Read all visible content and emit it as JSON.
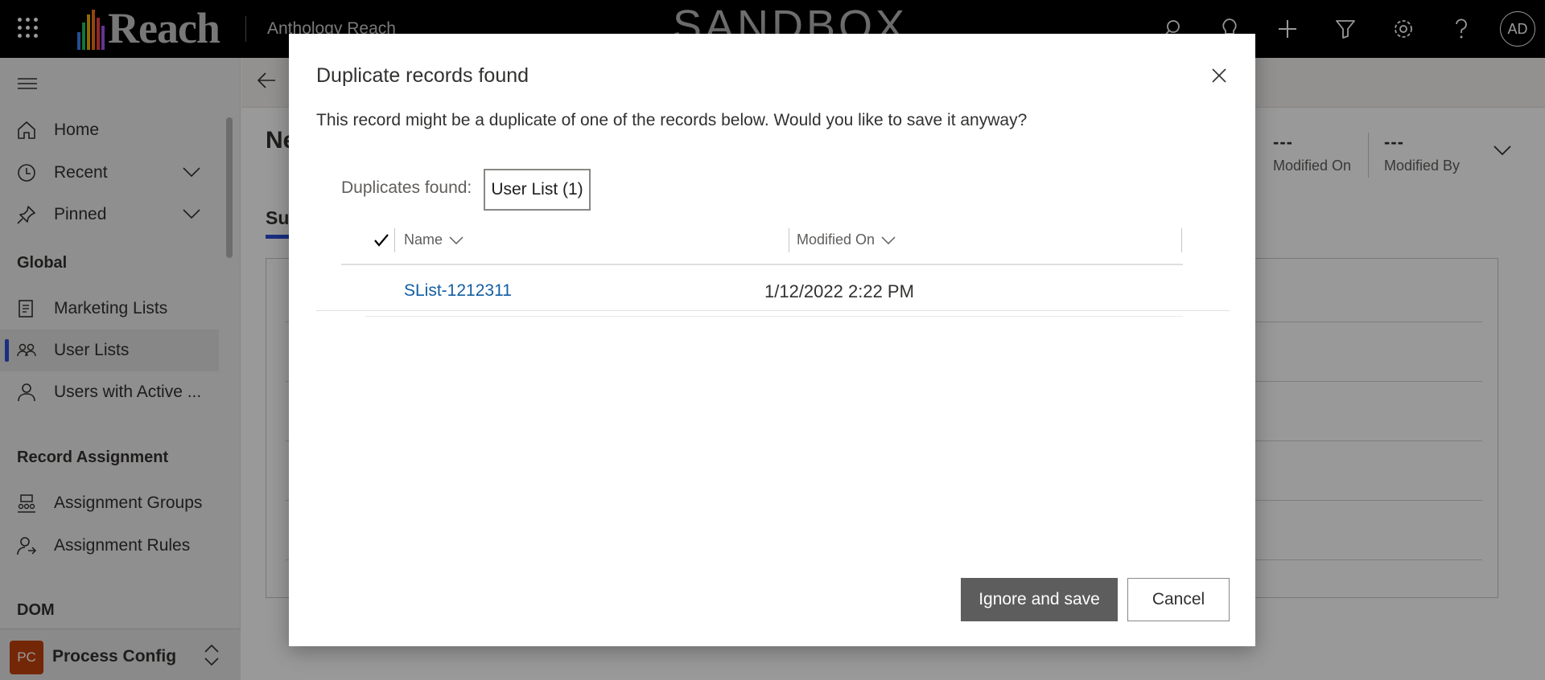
{
  "topbar": {
    "logo_text": "Reach",
    "app_name": "Anthology Reach",
    "environment_banner": "SANDBOX",
    "icons": [
      "search-icon",
      "lightbulb-icon",
      "plus-icon",
      "filter-icon",
      "gear-icon",
      "help-icon"
    ],
    "user_initials": "AD"
  },
  "sidebar": {
    "items_top": [
      {
        "label": "Home",
        "icon": "home-icon"
      },
      {
        "label": "Recent",
        "icon": "clock-icon"
      },
      {
        "label": "Pinned",
        "icon": "pin-icon"
      }
    ],
    "group_global": "Global",
    "items_global": [
      {
        "label": "Marketing Lists",
        "icon": "marketing-list-icon"
      },
      {
        "label": "User Lists",
        "icon": "users-icon"
      },
      {
        "label": "Users with Active ...",
        "icon": "user-icon"
      }
    ],
    "group_assignment": "Record Assignment",
    "items_assignment": [
      {
        "label": "Assignment Groups",
        "icon": "assignment-groups-icon"
      },
      {
        "label": "Assignment Rules",
        "icon": "assignment-rules-icon"
      }
    ],
    "group_dom": "DOM",
    "area": {
      "badge": "PC",
      "label": "Process Config"
    }
  },
  "background": {
    "page_title": "Ne",
    "tab_label": "Su",
    "header_fields": [
      {
        "value": "---",
        "label": "Modified On"
      },
      {
        "value": "---",
        "label": "Modified By"
      }
    ]
  },
  "dialog": {
    "title": "Duplicate records found",
    "message": "This record might be a duplicate of one of the records below. Would you like to save it anyway?",
    "duplicates_label": "Duplicates found:",
    "tab_label": "User List (1)",
    "columns": [
      "Name",
      "Modified On"
    ],
    "rows": [
      {
        "name": "SList-1212311",
        "modified_on": "1/12/2022 2:22 PM"
      }
    ],
    "primary_button": "Ignore and save",
    "secondary_button": "Cancel"
  },
  "colors": {
    "accent": "#2b4fd4",
    "link": "#115ea3",
    "primary_button": "#5d5d5d"
  }
}
